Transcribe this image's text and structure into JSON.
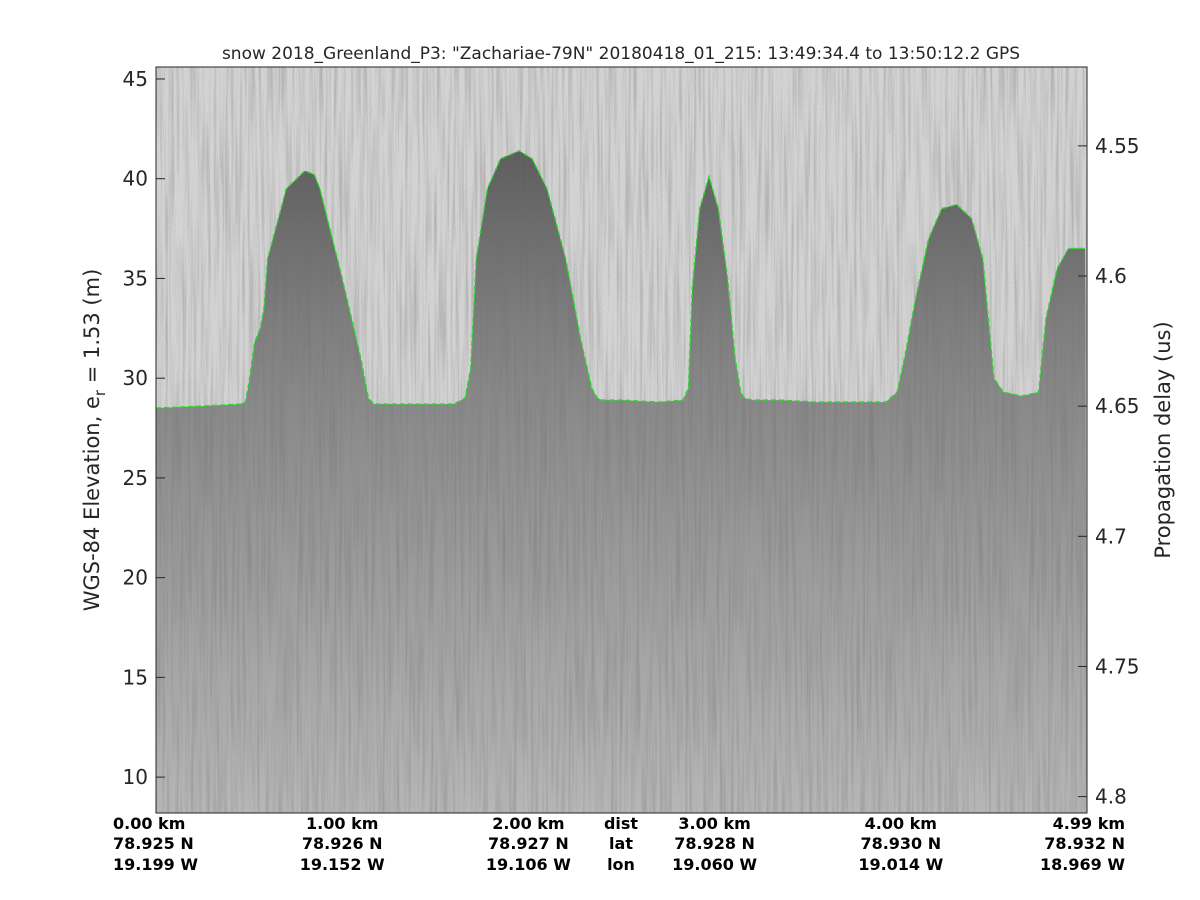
{
  "chart_data": {
    "type": "heatmap",
    "title": "snow 2018_Greenland_P3: \"Zachariae-79N\"  20180418_01_215: 13:49:34.4 to 13:50:12.2 GPS",
    "ylabel_left": "WGS-84 Elevation, e",
    "ylabel_left_sub": "r",
    "ylabel_left_tail": " = 1.53 (m)",
    "ylabel_right": "Propagation delay (us)",
    "ylim": [
      8.2,
      45.6
    ],
    "yticks_left": [
      10,
      15,
      20,
      25,
      30,
      35,
      40,
      45
    ],
    "yticks_left_labels": [
      "10",
      "15",
      "20",
      "25",
      "30",
      "35",
      "40",
      "45"
    ],
    "right_axis": {
      "delay_at_bottom": 4.8063,
      "delay_at_top": 4.5197
    },
    "yticks_right": [
      4.55,
      4.6,
      4.65,
      4.7,
      4.75,
      4.8
    ],
    "yticks_right_labels": [
      "4.55",
      "4.6",
      "4.65",
      "4.7",
      "4.75",
      "4.8"
    ],
    "xlim": [
      0,
      5.0
    ],
    "x_row_labels": [
      "dist",
      "lat",
      "lon"
    ],
    "x_ticks": [
      {
        "value": 0.0,
        "dist": "0.00 km",
        "lat": "78.925 N",
        "lon": "19.199 W"
      },
      {
        "value": 1.0,
        "dist": "1.00 km",
        "lat": "78.926 N",
        "lon": "19.152 W"
      },
      {
        "value": 2.0,
        "dist": "2.00 km",
        "lat": "78.927 N",
        "lon": "19.106 W"
      },
      {
        "value": 3.0,
        "dist": "3.00 km",
        "lat": "78.928 N",
        "lon": "19.060 W"
      },
      {
        "value": 4.0,
        "dist": "4.00 km",
        "lat": "78.930 N",
        "lon": "19.014 W"
      },
      {
        "value": 4.99,
        "dist": "4.99 km",
        "lat": "78.932 N",
        "lon": "18.969 W"
      }
    ],
    "colormap": "gray",
    "series": [
      {
        "style": "dashed",
        "color": "#22dd22",
        "x": [
          0.0,
          0.25,
          0.45,
          0.48,
          0.5,
          0.53,
          0.56,
          0.58,
          0.6,
          0.7,
          0.8,
          0.85,
          0.88,
          0.92,
          0.96,
          1.0,
          1.05,
          1.1,
          1.14,
          1.17,
          1.2,
          1.3,
          1.45,
          1.6,
          1.66,
          1.69,
          1.72,
          1.78,
          1.85,
          1.95,
          2.02,
          2.1,
          2.2,
          2.28,
          2.34,
          2.37,
          2.4,
          2.5,
          2.7,
          2.83,
          2.86,
          2.88,
          2.92,
          2.97,
          3.02,
          3.07,
          3.11,
          3.14,
          3.16,
          3.2,
          3.35,
          3.55,
          3.75,
          3.92,
          3.98,
          4.02,
          4.08,
          4.15,
          4.22,
          4.3,
          4.38,
          4.44,
          4.47,
          4.5,
          4.55,
          4.65,
          4.74,
          4.78,
          4.84,
          4.9,
          4.99
        ],
        "y": [
          28.5,
          28.6,
          28.7,
          28.8,
          29.8,
          31.8,
          32.5,
          33.5,
          36.0,
          39.5,
          40.4,
          40.2,
          39.5,
          38.0,
          36.5,
          35.0,
          33.0,
          31.0,
          29.0,
          28.7,
          28.7,
          28.7,
          28.7,
          28.7,
          29.0,
          30.5,
          36.0,
          39.5,
          41.0,
          41.4,
          41.0,
          39.5,
          36.0,
          32.0,
          29.5,
          29.0,
          28.9,
          28.9,
          28.8,
          28.9,
          29.5,
          34.5,
          38.5,
          40.1,
          38.5,
          35.0,
          31.0,
          29.3,
          29.0,
          28.9,
          28.9,
          28.8,
          28.8,
          28.8,
          29.3,
          31.0,
          34.0,
          37.0,
          38.5,
          38.7,
          38.0,
          36.0,
          33.0,
          30.0,
          29.3,
          29.1,
          29.3,
          33.0,
          35.5,
          36.5,
          36.5
        ]
      }
    ]
  }
}
